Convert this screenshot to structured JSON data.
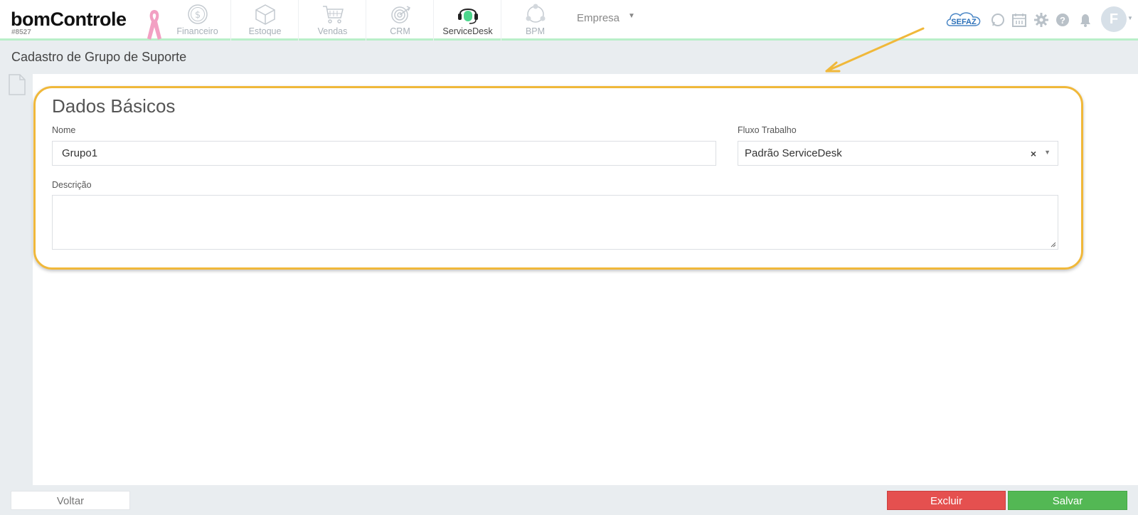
{
  "app": {
    "logo_text": "bomControle",
    "logo_id": "#8527"
  },
  "modules": [
    {
      "label": "Financeiro",
      "icon": "dollar-coin-icon",
      "active": false
    },
    {
      "label": "Estoque",
      "icon": "box-icon",
      "active": false
    },
    {
      "label": "Vendas",
      "icon": "shopping-cart-icon",
      "active": false
    },
    {
      "label": "CRM",
      "icon": "target-icon",
      "active": false
    },
    {
      "label": "ServiceDesk",
      "icon": "headset-icon",
      "active": true
    },
    {
      "label": "BPM",
      "icon": "process-cycle-icon",
      "active": false
    }
  ],
  "company_selector": {
    "label": "Empresa"
  },
  "top_right": {
    "sefaz_label": "SEFAZ",
    "icons": [
      "whatsapp-icon",
      "calendar-icon",
      "gear-icon",
      "help-icon",
      "bell-icon"
    ],
    "avatar_initial": "F"
  },
  "page": {
    "title": "Cadastro de Grupo de Suporte"
  },
  "form": {
    "section_title": "Dados Básicos",
    "nome": {
      "label": "Nome",
      "value": "Grupo1"
    },
    "fluxo": {
      "label": "Fluxo Trabalho",
      "value": "Padrão ServiceDesk"
    },
    "descricao": {
      "label": "Descrição",
      "value": ""
    }
  },
  "footer": {
    "back_label": "Voltar",
    "delete_label": "Excluir",
    "save_label": "Salvar"
  },
  "colors": {
    "highlight": "#f0b83a",
    "delete": "#e5504f",
    "save": "#53b854",
    "active_module_accent": "#4cd68c"
  }
}
